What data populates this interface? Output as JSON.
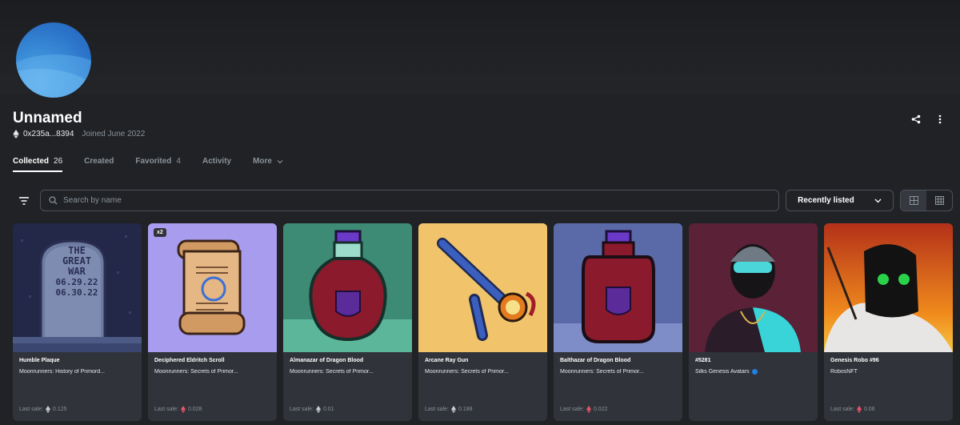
{
  "profile": {
    "name": "Unnamed",
    "address": "0x235a...8394",
    "joined": "Joined June 2022"
  },
  "tabs": [
    {
      "label": "Collected",
      "count": "26"
    },
    {
      "label": "Created",
      "count": ""
    },
    {
      "label": "Favorited",
      "count": "4"
    },
    {
      "label": "Activity",
      "count": ""
    },
    {
      "label": "More",
      "count": ""
    }
  ],
  "search": {
    "placeholder": "Search by name"
  },
  "sort": {
    "label": "Recently listed"
  },
  "cards": [
    {
      "title": "Humble Plaque",
      "collection": "Moonrunners: History of Primord...",
      "sale_label": "Last sale:",
      "sale_value": "0.125",
      "badge": "",
      "currency": "eth"
    },
    {
      "title": "Deciphered Eldritch Scroll",
      "collection": "Moonrunners: Secrets of Primor...",
      "sale_label": "Last sale:",
      "sale_value": "0.028",
      "badge": "x2",
      "currency": "weth"
    },
    {
      "title": "Almanazar of Dragon Blood",
      "collection": "Moonrunners: Secrets of Primor...",
      "sale_label": "Last sale:",
      "sale_value": "0.01",
      "badge": "",
      "currency": "eth"
    },
    {
      "title": "Arcane Ray Gun",
      "collection": "Moonrunners: Secrets of Primor...",
      "sale_label": "Last sale:",
      "sale_value": "0.188",
      "badge": "",
      "currency": "eth"
    },
    {
      "title": "Balthazar of Dragon Blood",
      "collection": "Moonrunners: Secrets of Primor...",
      "sale_label": "Last sale:",
      "sale_value": "0.022",
      "badge": "",
      "currency": "weth"
    },
    {
      "title": "#5281",
      "collection": "Silks Genesis Avatars",
      "sale_label": "",
      "sale_value": "",
      "badge": "",
      "currency": ""
    },
    {
      "title": "Genesis Robo #96",
      "collection": "RobosNFT",
      "sale_label": "Last sale:",
      "sale_value": "0.06",
      "badge": "",
      "currency": "weth"
    }
  ],
  "plaque_text": [
    "THE",
    "GREAT",
    "WAR",
    "06.29.22",
    "06.30.22"
  ],
  "colors": {
    "accent": "#2081e2",
    "background": "#202225",
    "card": "#303339",
    "weth": "#e8546b"
  },
  "icons": [
    "ethereum-icon",
    "share-icon",
    "more-icon",
    "filter-icon",
    "search-icon",
    "chevron-down-icon",
    "grid-large-icon",
    "grid-small-icon",
    "verified-icon"
  ]
}
